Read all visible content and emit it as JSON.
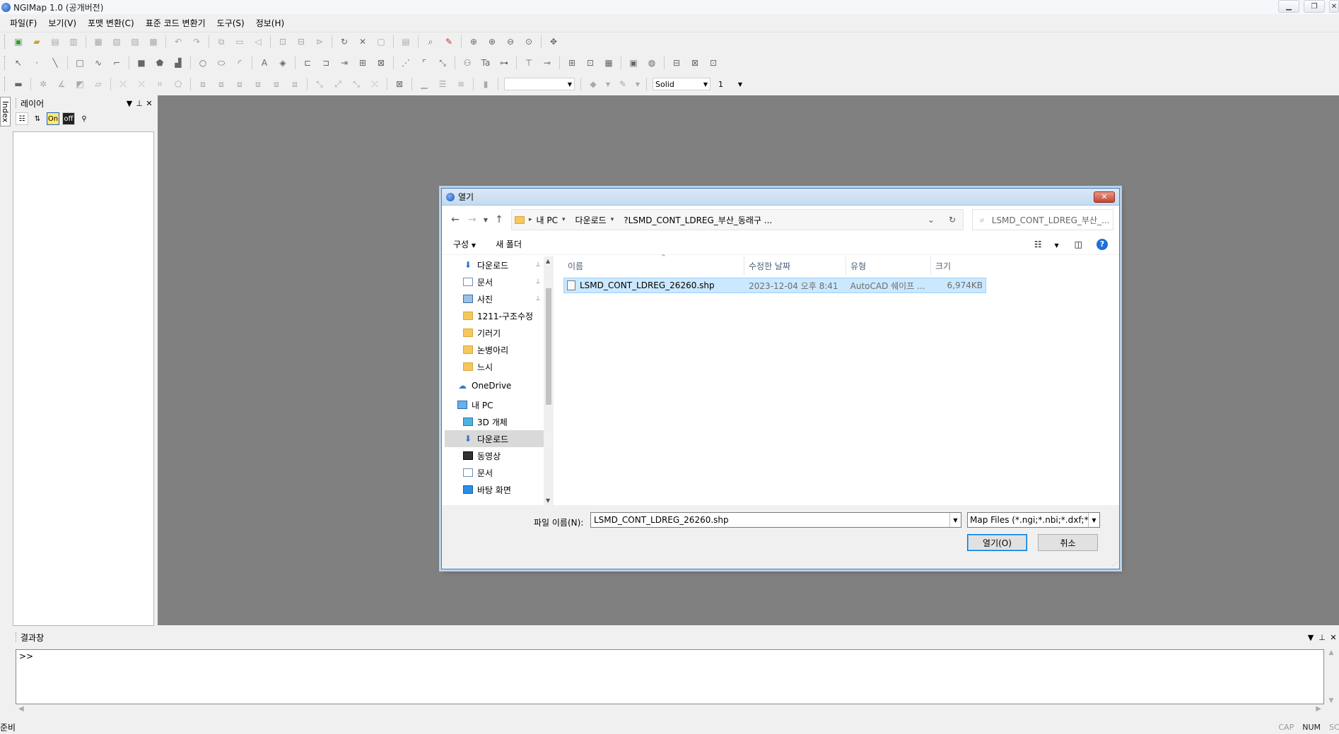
{
  "window": {
    "title": "NGIMap 1.0 (공개버전)"
  },
  "menu": [
    "파일(F)",
    "보기(V)",
    "포맷 변환(C)",
    "표준 코드 변환기",
    "도구(S)",
    "정보(H)"
  ],
  "toolbar3": {
    "line_style": "Solid",
    "line_width": "1"
  },
  "index_tab": "Index",
  "layer_panel": {
    "title": "레이어"
  },
  "result_panel": {
    "title": "결과창",
    "prompt": ">>"
  },
  "status": {
    "text": "준비",
    "indicators": [
      "CAP",
      "NUM",
      "SCRL"
    ]
  },
  "dialog": {
    "title": "열기",
    "address": {
      "crumbs": [
        "내 PC",
        "다운로드",
        "?LSMD_CONT_LDREG_부산_동래구 ..."
      ]
    },
    "search_placeholder": "LSMD_CONT_LDREG_부산_...",
    "commands": {
      "organize": "구성",
      "new_folder": "새 폴더"
    },
    "nav_items": [
      {
        "label": "다운로드",
        "icon": "download-arrow-icon",
        "pinned": true
      },
      {
        "label": "문서",
        "icon": "document-icon",
        "pinned": true
      },
      {
        "label": "사진",
        "icon": "pictures-icon",
        "pinned": true
      },
      {
        "label": "1211-구조수정",
        "icon": "folder-icon",
        "pinned": false
      },
      {
        "label": "기러기",
        "icon": "folder-icon",
        "pinned": false
      },
      {
        "label": "논병아리",
        "icon": "folder-icon",
        "pinned": false
      },
      {
        "label": "느시",
        "icon": "folder-icon",
        "pinned": false
      },
      {
        "label": "OneDrive",
        "icon": "onedrive-cloud-icon",
        "pinned": false
      },
      {
        "label": "내 PC",
        "icon": "computer-icon",
        "pinned": false
      },
      {
        "label": "3D 개체",
        "icon": "3d-objects-icon",
        "pinned": false
      },
      {
        "label": "다운로드",
        "icon": "download-arrow-icon",
        "pinned": false,
        "selected": true
      },
      {
        "label": "동영상",
        "icon": "videos-icon",
        "pinned": false
      },
      {
        "label": "문서",
        "icon": "document-icon",
        "pinned": false
      },
      {
        "label": "바탕 화면",
        "icon": "desktop-icon",
        "pinned": false
      }
    ],
    "columns": {
      "name": "이름",
      "date": "수정한 날짜",
      "type": "유형",
      "size": "크기"
    },
    "files": [
      {
        "name": "LSMD_CONT_LDREG_26260.shp",
        "date": "2023-12-04 오후 8:41",
        "type": "AutoCAD 쉐이프 ...",
        "size": "6,974KB"
      }
    ],
    "filename_label": "파일 이름(N):",
    "filename_value": "LSMD_CONT_LDREG_26260.shp",
    "filter_value": "Map Files (*.ngi;*.nbi;*.dxf;*.sh",
    "open_button": "열기(O)",
    "cancel_button": "취소"
  }
}
